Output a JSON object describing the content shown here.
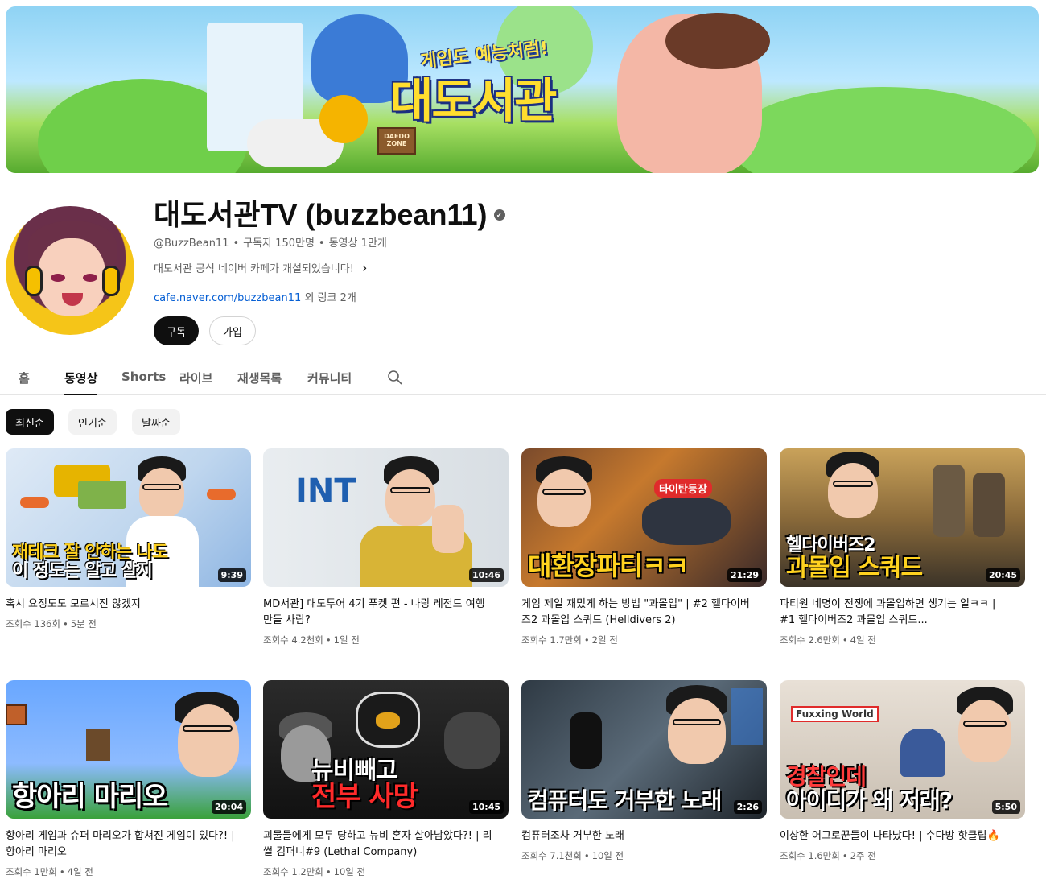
{
  "banner": {
    "tagline": "게임도 예능처럼!",
    "logo_text": "대도서관",
    "sign_text": "DAEDO ZONE"
  },
  "channel": {
    "title": "대도서관TV (buzzbean11)",
    "handle": "@BuzzBean11",
    "subscribers": "구독자 150만명",
    "video_count": "동영상 1만개",
    "description": "대도서관 공식 네이버 카페가 개설되었습니다!",
    "link_url": "cafe.naver.com/buzzbean11",
    "link_more": "외 링크 2개",
    "subscribe_label": "구독",
    "join_label": "가입"
  },
  "tabs": [
    {
      "label": "홈"
    },
    {
      "label": "동영상",
      "active": true
    },
    {
      "label": "Shorts"
    },
    {
      "label": "라이브"
    },
    {
      "label": "재생목록"
    },
    {
      "label": "커뮤니티"
    }
  ],
  "chips": [
    {
      "label": "최신순",
      "selected": true
    },
    {
      "label": "인기순"
    },
    {
      "label": "날짜순"
    }
  ],
  "videos": [
    {
      "title": "혹시 요정도도 모르시진 않겠지",
      "views": "조회수 136회",
      "age": "5분 전",
      "duration": "9:39",
      "caption": [
        "재테크 잘 안하는 나도",
        "이 정도는 알고 살지"
      ]
    },
    {
      "title": "MD서관] 대도투어 4기 푸켓 편 - 나랑 레전드 여행 만들 사람?",
      "views": "조회수 4.2천회",
      "age": "1일 전",
      "duration": "10:46",
      "caption": []
    },
    {
      "title": "게임 제일 재밌게 하는 방법 \"과몰입\" | #2 헬다이버즈2 과몰입 스쿼드 (Helldivers 2)",
      "views": "조회수 1.7만회",
      "age": "2일 전",
      "duration": "21:29",
      "caption": [
        "대환장파티ㅋㅋ"
      ]
    },
    {
      "title": "파티원 네명이 전쟁에 과몰입하면 생기는 일ㅋㅋ | #1 헬다이버즈2 과몰입 스쿼드...",
      "views": "조회수 2.6만회",
      "age": "4일 전",
      "duration": "20:45",
      "caption": [
        "헬다이버즈2",
        "과몰입 스쿼드"
      ]
    },
    {
      "title": "항아리 게임과 슈퍼 마리오가 합쳐진 게임이 있다?! | 항아리 마리오",
      "views": "조회수 1만회",
      "age": "4일 전",
      "duration": "20:04",
      "caption": [
        "항아리 마리오"
      ]
    },
    {
      "title": "괴물들에게 모두 당하고 뉴비 혼자 살아남았다?! | 리썰 컴퍼니#9 (Lethal Company)",
      "views": "조회수 1.2만회",
      "age": "10일 전",
      "duration": "10:45",
      "caption": [
        "뉴비빼고",
        "전부 사망"
      ]
    },
    {
      "title": "컴퓨터조차 거부한 노래",
      "views": "조회수 7.1천회",
      "age": "10일 전",
      "duration": "2:26",
      "caption": [
        "컴퓨터도 거부한 노래"
      ]
    },
    {
      "title": "이상한 어그로꾼들이 나타났다! | 수다방 핫클립🔥",
      "views": "조회수 1.6만회",
      "age": "2주 전",
      "duration": "5:50",
      "caption": [
        "경찰인데",
        "아이디가 왜 저래?"
      ]
    }
  ]
}
